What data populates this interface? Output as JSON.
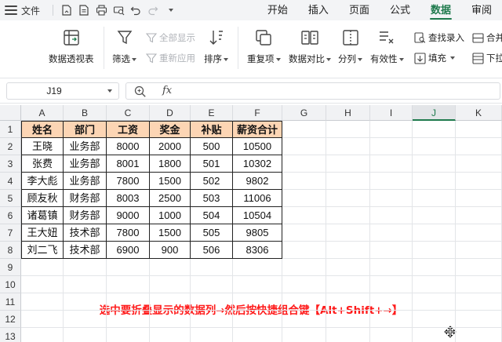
{
  "menubar": {
    "file_label": "文件",
    "tabs": [
      "开始",
      "插入",
      "页面",
      "公式",
      "数据",
      "审阅"
    ],
    "active_tab": "数据"
  },
  "ribbon": {
    "pivot_table": "数据透视表",
    "filter": "筛选",
    "show_all": "全部显示",
    "reapply": "重新应用",
    "sort": "排序",
    "duplicates": "重复项",
    "compare": "数据对比",
    "split": "分列",
    "validity": "有效性",
    "find_entry": "查找录入",
    "fill": "填充",
    "merge_partial": "合并",
    "dropdown_partial": "下拉"
  },
  "formula_bar": {
    "name_box": "J19",
    "fx_label": "fx",
    "formula": ""
  },
  "sheet": {
    "columns": [
      "A",
      "B",
      "C",
      "D",
      "E",
      "F",
      "G",
      "H",
      "I",
      "J",
      "K"
    ],
    "active_column": "J",
    "rows": [
      "1",
      "2",
      "3",
      "4",
      "5",
      "6",
      "7",
      "8",
      "9",
      "10",
      "11",
      "12",
      "13"
    ],
    "table": {
      "header": [
        "姓名",
        "部门",
        "工资",
        "奖金",
        "补贴",
        "薪资合计"
      ],
      "body": [
        [
          "王晓",
          "业务部",
          "8000",
          "2000",
          "500",
          "10500"
        ],
        [
          "张费",
          "业务部",
          "8001",
          "1800",
          "501",
          "10302"
        ],
        [
          "李大彪",
          "业务部",
          "7800",
          "1500",
          "502",
          "9802"
        ],
        [
          "顾友秋",
          "财务部",
          "8003",
          "2500",
          "503",
          "11006"
        ],
        [
          "诸葛镇",
          "财务部",
          "9000",
          "1000",
          "504",
          "10504"
        ],
        [
          "王大妞",
          "技术部",
          "7800",
          "1500",
          "505",
          "9805"
        ],
        [
          "刘二飞",
          "技术部",
          "6900",
          "900",
          "506",
          "8306"
        ]
      ]
    }
  },
  "annotation": "选中要折叠显示的数据列→然后按快捷组合键【Alt+Shift+→】",
  "colors": {
    "accent": "#1f7a4d",
    "header_fill": "#fcd5b4",
    "annotation": "#ff1a1a"
  }
}
